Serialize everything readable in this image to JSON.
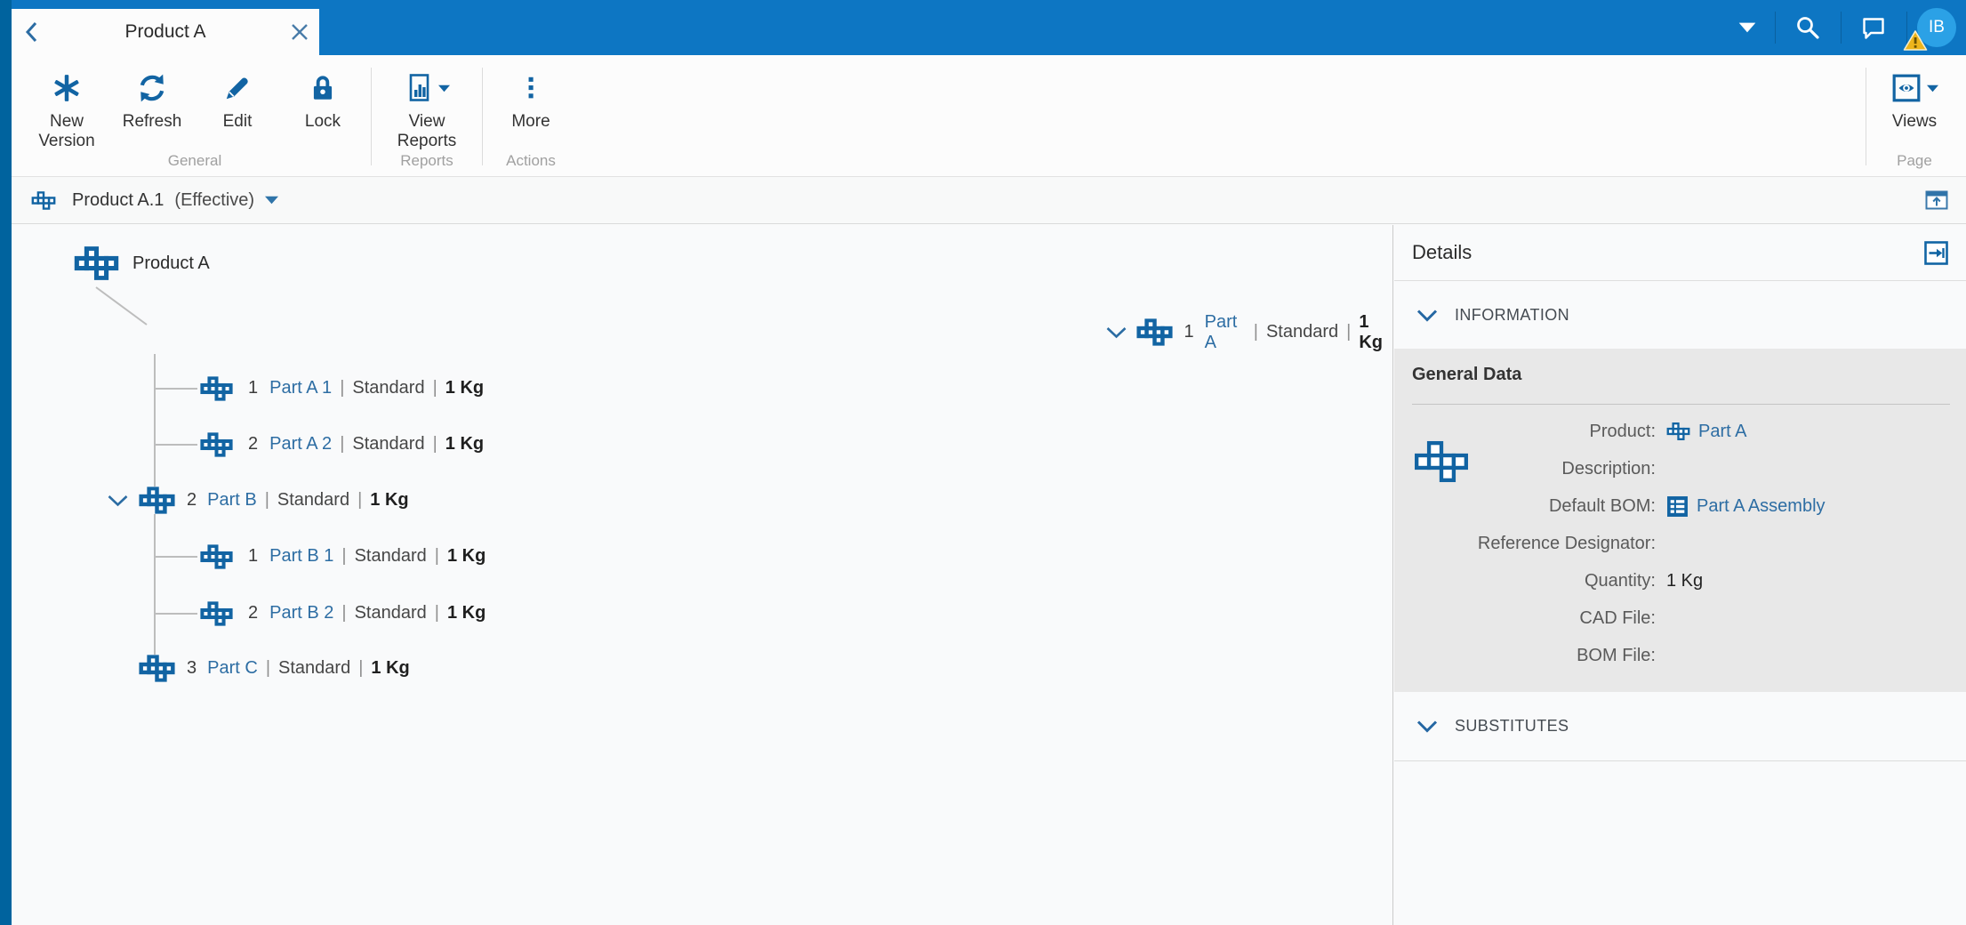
{
  "colors": {
    "topbar": "#0d76c3",
    "left_strip": "#00639e",
    "avatar": "#2ba1e6",
    "icon_blue": "#1264a3",
    "link_blue": "#2d6da3",
    "selected_row": "#dce7f3",
    "panel_gray": "#e8e8e8",
    "warning_yellow": "#edb51c"
  },
  "topbar": {
    "tab_title": "Product A",
    "back_icon": "chevron-left-icon",
    "close_icon": "close-icon",
    "right_icons": [
      "caret-down-icon",
      "search-icon",
      "chat-icon"
    ],
    "avatar_initials": "IB",
    "avatar_badge": "warning-triangle-icon"
  },
  "toolbar": {
    "groups": [
      {
        "label": "General",
        "buttons": [
          {
            "label": "New Version",
            "icon": "new-version-asterisk-icon"
          },
          {
            "label": "Refresh",
            "icon": "refresh-icon"
          },
          {
            "label": "Edit",
            "icon": "pencil-icon"
          },
          {
            "label": "Lock",
            "icon": "lock-icon"
          }
        ]
      },
      {
        "label": "Reports",
        "buttons": [
          {
            "label": "View Reports",
            "icon": "report-document-icon",
            "has_caret": true
          }
        ]
      },
      {
        "label": "Actions",
        "buttons": [
          {
            "label": "More",
            "icon": "more-dots-icon"
          }
        ]
      },
      {
        "label": "Page",
        "buttons": [
          {
            "label": "Views",
            "icon": "eye-views-icon",
            "has_caret": true
          }
        ]
      }
    ]
  },
  "breadcrumb": {
    "icon": "part-icon",
    "title": "Product A.1",
    "state": "(Effective)",
    "caret_icon": "caret-down-icon",
    "right_icon": "window-up-arrow-icon"
  },
  "tree": {
    "pipe": "|",
    "root": {
      "label": "Product A",
      "icon": "part-icon"
    },
    "rows": [
      {
        "level": 1,
        "seq": "1",
        "name": "Part A",
        "type": "Standard",
        "qty": "1 Kg",
        "expanded": true,
        "selected": true
      },
      {
        "level": 2,
        "seq": "1",
        "name": "Part A 1",
        "type": "Standard",
        "qty": "1 Kg"
      },
      {
        "level": 2,
        "seq": "2",
        "name": "Part A 2",
        "type": "Standard",
        "qty": "1 Kg"
      },
      {
        "level": 1,
        "seq": "2",
        "name": "Part B",
        "type": "Standard",
        "qty": "1 Kg",
        "expanded": true
      },
      {
        "level": 2,
        "seq": "1",
        "name": "Part B 1",
        "type": "Standard",
        "qty": "1 Kg"
      },
      {
        "level": 2,
        "seq": "2",
        "name": "Part B 2",
        "type": "Standard",
        "qty": "1 Kg"
      },
      {
        "level": 1,
        "seq": "3",
        "name": "Part C",
        "type": "Standard",
        "qty": "1 Kg"
      }
    ]
  },
  "details": {
    "title": "Details",
    "expand_icon": "open-panel-arrow-icon",
    "information_label": "INFORMATION",
    "substitutes_label": "SUBSTITUTES",
    "general": {
      "heading": "General Data",
      "big_icon": "part-icon",
      "fields": [
        {
          "label": "Product:",
          "value": "Part A",
          "icon": "part-icon",
          "link": true
        },
        {
          "label": "Description:",
          "value": ""
        },
        {
          "label": "Default BOM:",
          "value": "Part A Assembly",
          "icon": "bom-table-icon",
          "link": true
        },
        {
          "label": "Reference Designator:",
          "value": ""
        },
        {
          "label": "Quantity:",
          "value": "1 Kg"
        },
        {
          "label": "CAD File:",
          "value": ""
        },
        {
          "label": "BOM File:",
          "value": ""
        }
      ]
    }
  }
}
